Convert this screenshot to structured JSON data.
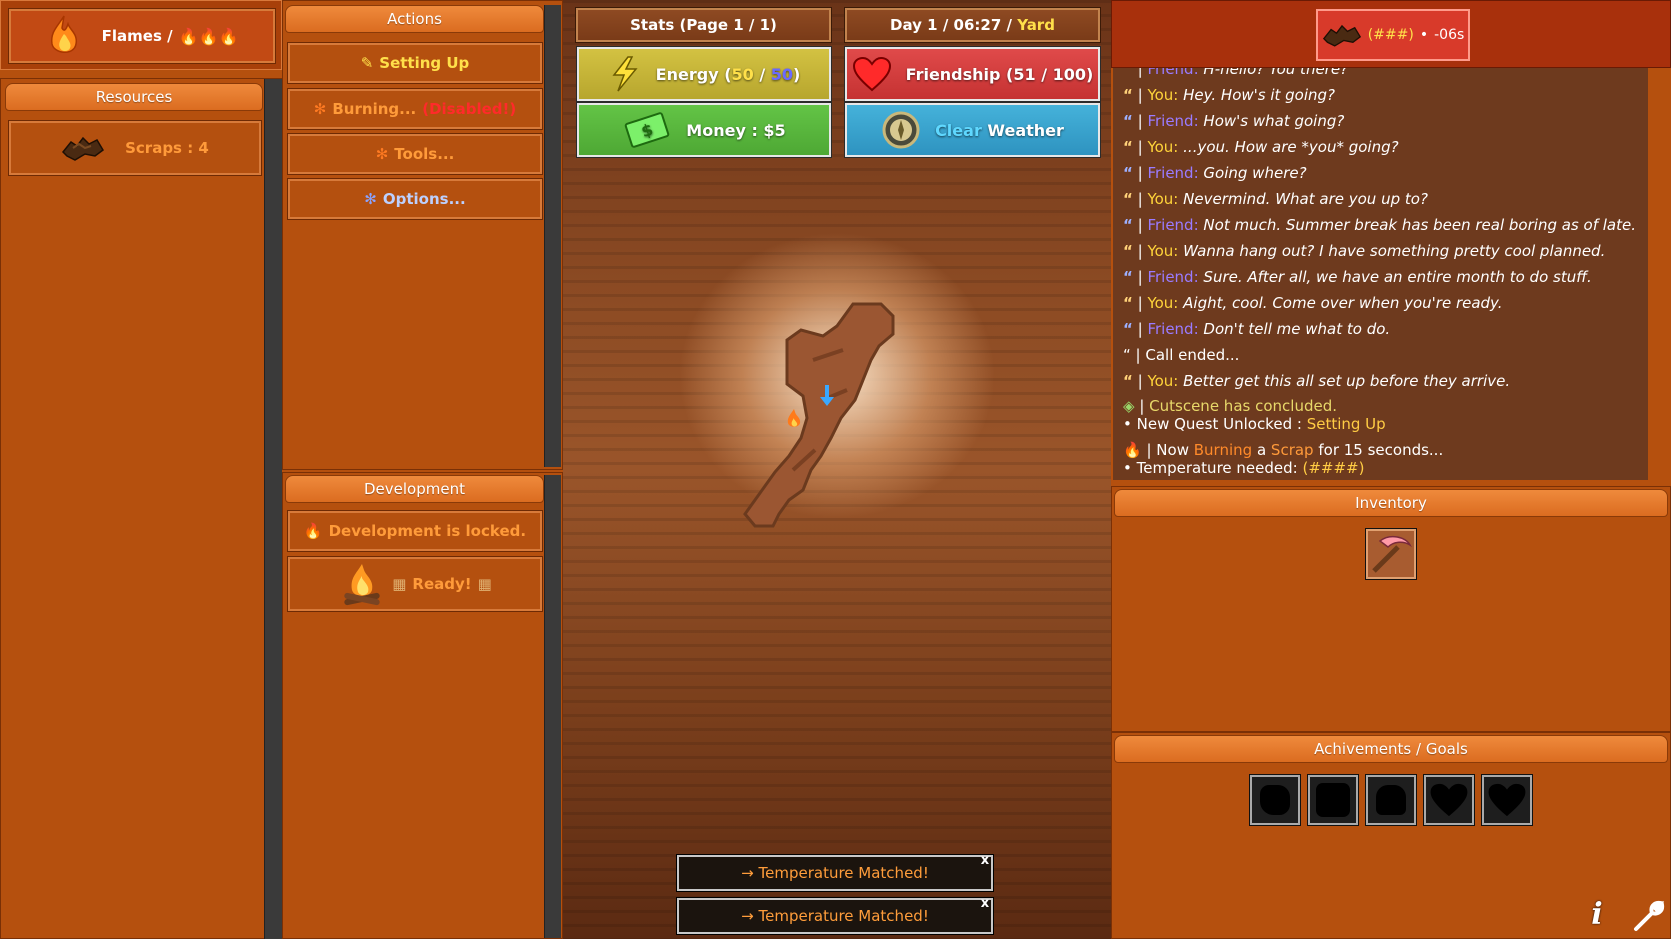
{
  "flames_panel": {
    "label": "Flames /"
  },
  "resources": {
    "header": "Resources",
    "items": [
      {
        "label": "Scraps : 4",
        "icon": "scrap-icon"
      }
    ]
  },
  "actions": {
    "header": "Actions",
    "buttons": [
      {
        "label": "Setting Up",
        "prefix": "✎",
        "icon": "pencil-icon"
      },
      {
        "label": "Burning...",
        "suffix": "(Disabled!)",
        "prefix": "✻"
      },
      {
        "label": "Tools...",
        "prefix": "✻"
      },
      {
        "label": "Options...",
        "prefix": "✻"
      }
    ]
  },
  "development": {
    "header": "Development",
    "locked_label": "Development is locked.",
    "ready_label": "Ready!"
  },
  "stats": {
    "page_label": "Stats (Page 1 / 1)",
    "day_prefix": "Day 1 / 06:27 /",
    "location": "Yard",
    "energy_label": "Energy (",
    "energy_current": "50",
    "energy_sep": " / ",
    "energy_max": "50",
    "energy_close": ")",
    "friendship_label": "Friendship (51 / 100)",
    "money_label": "Money : $5",
    "weather_word1": "Clear",
    "weather_word2": "Weather"
  },
  "timer": {
    "temp": "(###)",
    "sep": "•",
    "time": "-06s"
  },
  "log": [
    {
      "kind": "you-cut",
      "speaker": "Friend:",
      "text": "H-hello? You there?"
    },
    {
      "kind": "you",
      "speaker": "You:",
      "text": "Hey. How's it going?"
    },
    {
      "kind": "friend",
      "speaker": "Friend:",
      "text": "How's what going?"
    },
    {
      "kind": "you",
      "speaker": "You:",
      "text": "...you. How are *you* going?"
    },
    {
      "kind": "friend",
      "speaker": "Friend:",
      "text": "Going where?"
    },
    {
      "kind": "you",
      "speaker": "You:",
      "text": "Nevermind. What are you up to?"
    },
    {
      "kind": "friend",
      "speaker": "Friend:",
      "text": "Not much. Summer break has been real boring as of late."
    },
    {
      "kind": "you",
      "speaker": "You:",
      "text": "Wanna hang out? I have something pretty cool planned."
    },
    {
      "kind": "friend",
      "speaker": "Friend:",
      "text": "Sure. After all, we have an entire month to do stuff."
    },
    {
      "kind": "you",
      "speaker": "You:",
      "text": "Aight, cool. Come over when you're ready."
    },
    {
      "kind": "friend",
      "speaker": "Friend:",
      "text": "Don't tell me what to do."
    },
    {
      "kind": "system",
      "text": "Call ended..."
    },
    {
      "kind": "you",
      "speaker": "You:",
      "text": "Better get this all set up before they arrive."
    }
  ],
  "log_cutscene": "Cutscene has concluded.",
  "log_quest_prefix": "• New Quest Unlocked :",
  "log_quest_name": "Setting Up",
  "log_burn": {
    "prefix": "Now",
    "burning": "Burning",
    "a": "a",
    "scrap": "Scrap",
    "rest": "for 15 seconds..."
  },
  "log_temp_prefix": "• Temperature needed:",
  "log_temp_value": "(####)",
  "inventory": {
    "header": "Inventory",
    "items": [
      "pickaxe-icon"
    ]
  },
  "achievements": {
    "header": "Achivements / Goals",
    "count": 5
  },
  "toasts": [
    "→ Temperature Matched!",
    "→ Temperature Matched!"
  ],
  "corner": {
    "info": "i"
  },
  "colors": {
    "panel_bg": "#b5500e",
    "header_orange": "#e57a2c",
    "energy_tile": "#c8b83a",
    "friendship_tile": "#d94040",
    "money_tile": "#58b83c",
    "weather_tile": "#3aa6cf",
    "you_color": "#ffd43a",
    "friend_color": "#9a7bff"
  }
}
